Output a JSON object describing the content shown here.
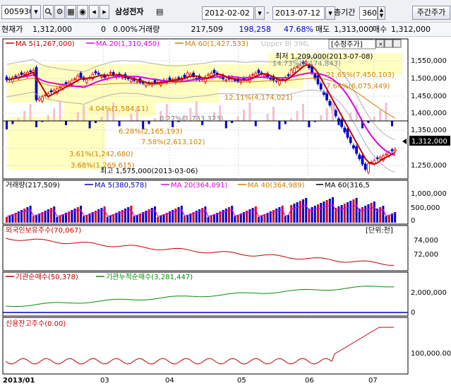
{
  "toolbar": {
    "stock_code": "005930",
    "stock_name": "삼성전자",
    "date_from": "2012-02-02",
    "date_to": "2013-07-12",
    "period_label": "총기간",
    "period_value": "360",
    "adjusted_button": "주간주가"
  },
  "quote": {
    "price_label": "현재가",
    "price": "1,312,000",
    "change": "0",
    "change_pct": "0.00%",
    "volume_label": "거래량",
    "volume": "217,509",
    "value_change": "198,258",
    "ratio": "47.68%",
    "ask_label": "매도",
    "ask": "1,313,000",
    "bid_label": "매수",
    "bid": "1,312,000"
  },
  "colors": {
    "up": "#e00000",
    "down": "#0000cc",
    "ma5": "#c00000",
    "ma20": "#e000e0",
    "ma60": "#d08000",
    "bollinger": "#a0a0a0",
    "accumulate": "#009000",
    "grid": "#c0c0c0",
    "bg_highlight": "#ffffc0"
  },
  "price_panel": {
    "legend": [
      {
        "label": "MA 5(1,267,000)",
        "color": "#c00000"
      },
      {
        "label": "MA 20(1,310,450)",
        "color": "#e000e0"
      },
      {
        "label": "MA 60(1,427,533)",
        "color": "#d08000"
      },
      {
        "label": "Upper Bl 396,",
        "color": "#c0c0c0"
      }
    ],
    "tag": "[수정주가]",
    "y_ticks": [
      "1,550,000",
      "1,500,000",
      "1,450,000",
      "1,400,000",
      "1,350,000",
      "1,300,000",
      "1,250,000"
    ],
    "current_price_tag": "1,312,000",
    "annotations": [
      "최저 1,209,000(2013-07-08)",
      "14.73%(4,174,843)",
      "21.65%(7,450,103)",
      "7.64%(6,075,449)",
      "12.11%(4,174,021)",
      "4.04%(1,584,11)",
      "0.27%(1,733,323)",
      "6.28%(2,165,193)",
      "7.58%(2,613,102)",
      "3.61%(1,242,680)",
      "3.68%(1,269,615)",
      "최고 1,575,000(2013-03-06)"
    ]
  },
  "volume_panel": {
    "legend": [
      {
        "label": "거래량(217,509)",
        "color": "#000000"
      },
      {
        "label": "MA 5(380,578)",
        "color": "#0000cc"
      },
      {
        "label": "MA 20(364,091)",
        "color": "#e000e0"
      },
      {
        "label": "MA 40(364,989)",
        "color": "#d08000"
      },
      {
        "label": "MA 60(316,5",
        "color": "#000000"
      }
    ],
    "y_ticks": [
      "1,000,000",
      "500,000",
      "0"
    ]
  },
  "foreign_panel": {
    "legend": "외국인보유주수(70,067)",
    "unit": "[단위:천]",
    "y_ticks": [
      "74,000",
      "72,000"
    ]
  },
  "institution_panel": {
    "legend": [
      {
        "label": "기관순매수(50,378)",
        "color": "#c00000"
      },
      {
        "label": "기관누적순매수(3,281,447)",
        "color": "#009000"
      }
    ],
    "y_ticks": [
      "2,000,000",
      "0"
    ]
  },
  "credit_panel": {
    "legend": "신용잔고주수(0.00)",
    "y_ticks": [
      "100,000.00"
    ]
  },
  "x_axis": [
    "2013/01",
    "03",
    "04",
    "05",
    "06",
    "07"
  ]
}
